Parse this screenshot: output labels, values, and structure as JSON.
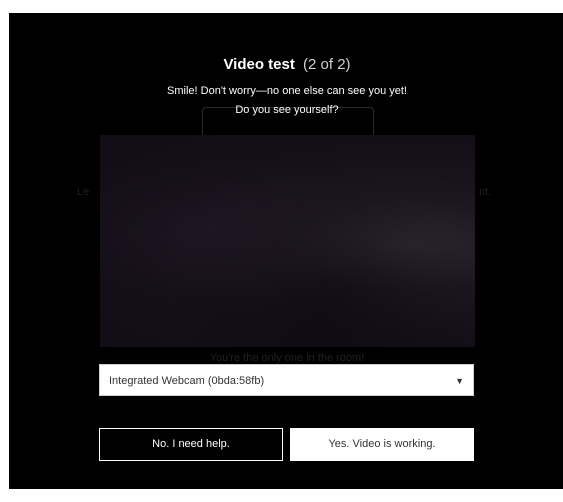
{
  "dialog": {
    "title": "Video test",
    "step": "(2 of 2)",
    "subtitle_line1": "Smile! Don't worry—no one else can see you yet!",
    "subtitle_line2": "Do you see yourself?"
  },
  "background_ghost": {
    "left_fragment": "Le",
    "right_fragment": "nt.",
    "bottom_text": "You're the only one in the room!"
  },
  "camera_select": {
    "value": "Integrated Webcam (0bda:58fb)",
    "caret": "▼"
  },
  "buttons": {
    "no_label": "No. I need help.",
    "yes_label": "Yes. Video is working."
  },
  "colors": {
    "dialog_bg": "#000000",
    "video_bg": "#150f19",
    "button_light": "#ffffff"
  }
}
